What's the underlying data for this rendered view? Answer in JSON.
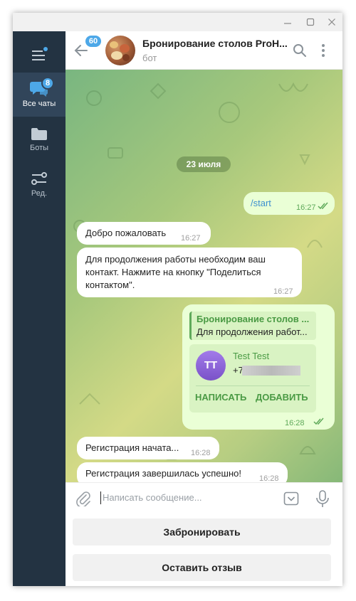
{
  "window": {
    "controls": [
      "minimize",
      "maximize",
      "close"
    ]
  },
  "sidebar": {
    "menu_icon": "hamburger-icon",
    "items": [
      {
        "label": "Все чаты",
        "icon": "chats-icon",
        "badge": "8",
        "active": true
      },
      {
        "label": "Боты",
        "icon": "folder-icon"
      },
      {
        "label": "Ред.",
        "icon": "filters-icon"
      }
    ]
  },
  "header": {
    "unread_badge": "60",
    "title": "Бронирование столов ProH...",
    "subtitle": "бот"
  },
  "chat": {
    "date": "23 июля",
    "messages": [
      {
        "dir": "out",
        "text": "/start",
        "time": "16:27",
        "read": true
      },
      {
        "dir": "in",
        "text": "Добро пожаловать",
        "time": "16:27"
      },
      {
        "dir": "in",
        "lines": [
          "Для продолжения работы необходим ваш",
          "контакт. Нажмите на кнопку \"Поделиться",
          "контактом\"."
        ],
        "time": "16:27"
      },
      {
        "dir": "out",
        "reply": {
          "title": "Бронирование столов ...",
          "text": "Для продолжения работ..."
        },
        "contact": {
          "initials": "TT",
          "name": "Test Test",
          "phone": "+7",
          "actions": [
            "НАПИСАТЬ",
            "ДОБАВИТЬ"
          ]
        },
        "time": "16:28",
        "read": true
      },
      {
        "dir": "in",
        "text": "Регистрация начата...",
        "time": "16:28"
      },
      {
        "dir": "in",
        "text": "Регистрация завершилась успешно!",
        "time": "16:28"
      }
    ]
  },
  "input": {
    "placeholder": "Написать сообщение..."
  },
  "keyboard": {
    "buttons": [
      "Забронировать",
      "Оставить отзыв"
    ]
  },
  "colors": {
    "sidebar": "#233342",
    "accent": "#4da8e8",
    "outgoing": "#eaffd6",
    "green_text": "#4a9a44"
  }
}
